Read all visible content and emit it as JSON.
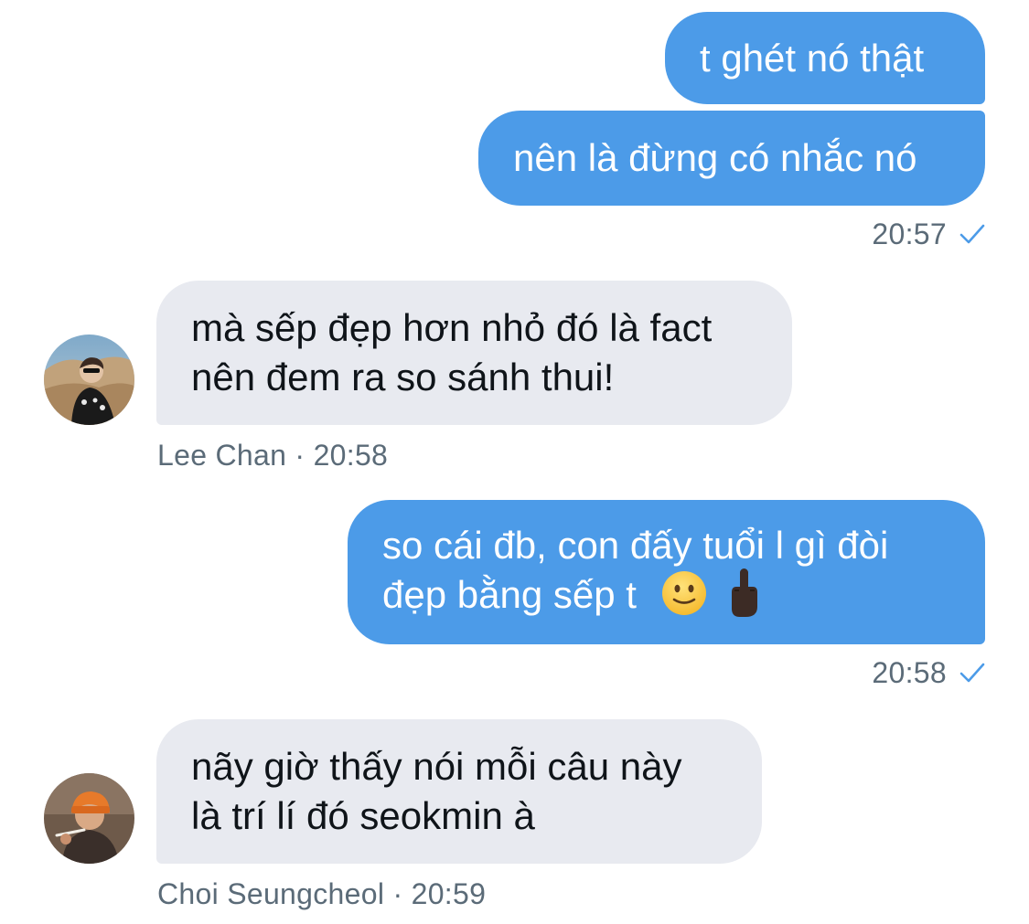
{
  "messages": [
    {
      "id": "m1",
      "direction": "outgoing",
      "lines": [
        "t ghét nó thật"
      ]
    },
    {
      "id": "m2",
      "direction": "outgoing",
      "lines": [
        "nên là đừng có nhắc nó"
      ]
    },
    {
      "id": "m3",
      "direction": "incoming",
      "lines": [
        "mà sếp đẹp hơn nhỏ đó là fact",
        "nên đem ra so sánh thui!"
      ]
    },
    {
      "id": "m4",
      "direction": "outgoing",
      "lines": [
        "so cái đb, con đấy tuổi l gì đòi",
        "đẹp bằng sếp t"
      ],
      "emojis": [
        "slightly-smiling-face-emoji",
        "middle-finger-emoji"
      ]
    },
    {
      "id": "m5",
      "direction": "incoming",
      "lines": [
        "nãy giờ thấy nói mỗi câu này",
        "là trí lí đó seokmin à"
      ]
    }
  ],
  "meta": {
    "group1_time": "20:57",
    "group2_sender": "Lee Chan",
    "group2_sep": "·",
    "group2_time": "20:58",
    "group3_time": "20:58",
    "group4_sender": "Choi Seungcheol",
    "group4_sep": "·",
    "group4_time": "20:59"
  },
  "colors": {
    "outgoing_bubble": "#4c9be8",
    "incoming_bubble": "#e8eaf0",
    "meta_text": "#5b6b78",
    "read_check": "#4c9be8"
  },
  "icons": {
    "read_receipt": "check-icon",
    "avatar1": "avatar-lee-chan",
    "avatar2": "avatar-choi-seungcheol"
  }
}
